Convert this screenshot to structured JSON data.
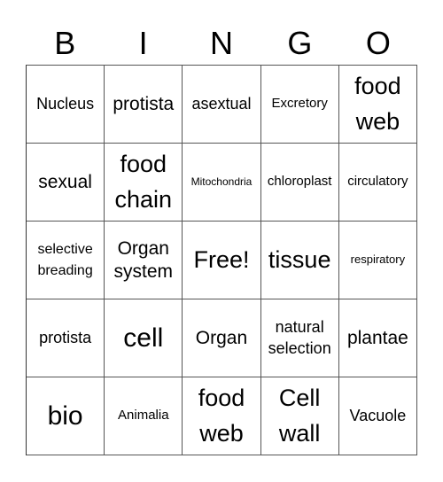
{
  "header": {
    "letters": [
      "B",
      "I",
      "N",
      "G",
      "O"
    ]
  },
  "card": {
    "rows": [
      [
        "Nucleus",
        "protista",
        "asextual",
        "Excretory",
        "food web"
      ],
      [
        "sexual",
        "food chain",
        "Mitochondria",
        "chloroplast",
        "circulatory"
      ],
      [
        "selective breading",
        "Organ system",
        "Free!",
        "tissue",
        "respiratory"
      ],
      [
        "protista",
        "cell",
        "Organ",
        "natural selection",
        "plantae"
      ],
      [
        "bio",
        "Animalia",
        "food web",
        "Cell wall",
        "Vacuole"
      ]
    ]
  }
}
